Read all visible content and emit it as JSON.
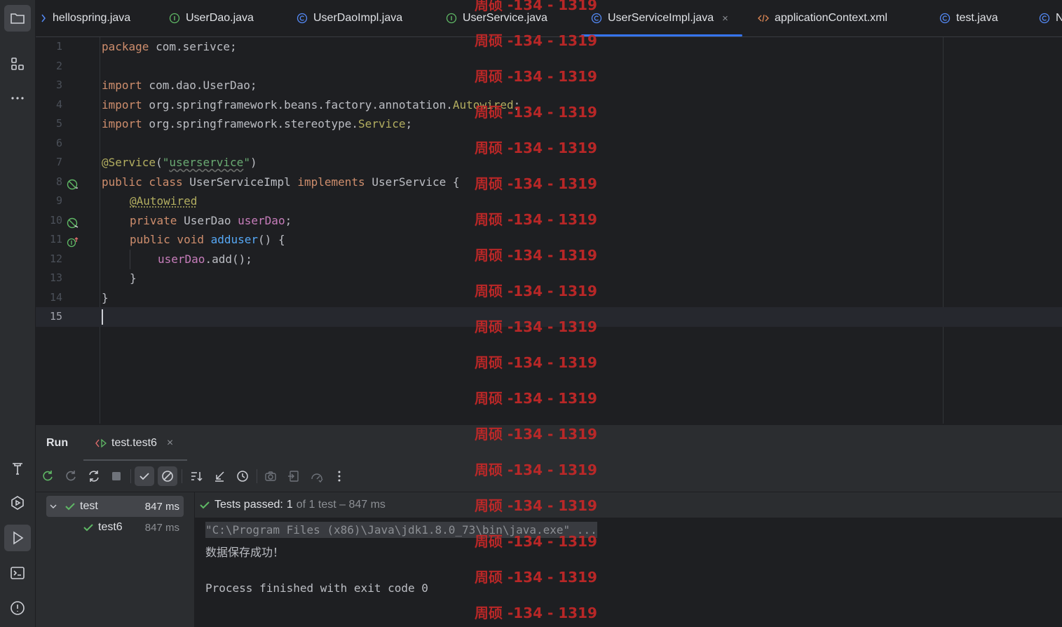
{
  "tabs": [
    {
      "label": "hellospring.java",
      "icon": "chevron-left-icon"
    },
    {
      "label": "UserDao.java",
      "icon": "interface-icon"
    },
    {
      "label": "UserDaoImpl.java",
      "icon": "class-icon"
    },
    {
      "label": "UserService.java",
      "icon": "interface-icon"
    },
    {
      "label": "UserServiceImpl.java",
      "icon": "class-icon",
      "active": true,
      "close": "×"
    },
    {
      "label": "applicationContext.xml",
      "icon": "xml-icon"
    },
    {
      "label": "test.java",
      "icon": "class-icon"
    },
    {
      "label": "N",
      "icon": "class-icon"
    }
  ],
  "editor": {
    "line_numbers": [
      "1",
      "2",
      "3",
      "4",
      "5",
      "6",
      "7",
      "8",
      "9",
      "10",
      "11",
      "12",
      "13",
      "14",
      "15"
    ],
    "current_line": "15",
    "code": {
      "l1_kw": "package",
      "l1_rest": " com.serivce;",
      "l3_kw": "import",
      "l3_rest": " com.dao.UserDao;",
      "l4_kw": "import",
      "l4_pre": " org.springframework.beans.factory.annotation.",
      "l4_ann": "Autowired",
      "l4_end": ";",
      "l5_kw": "import",
      "l5_pre": " org.springframework.stereotype.",
      "l5_ann": "Service",
      "l5_end": ";",
      "l7_ann": "@Service",
      "l7_open": "(",
      "l7_q1": "\"",
      "l7_str": "userservice",
      "l7_q2": "\"",
      "l7_close": ")",
      "l8_kw1": "public class",
      "l8_name": " UserServiceImpl ",
      "l8_kw2": "implements",
      "l8_iface": " UserService {",
      "l9_ann": "@Autowired",
      "l10_kw": "private",
      "l10_type": " UserDao ",
      "l10_field": "userDao",
      "l10_end": ";",
      "l11_kw": "public void",
      "l11_sp": " ",
      "l11_fn": "adduser",
      "l11_end": "() {",
      "l12_field": "userDao",
      "l12_end": ".add();",
      "l13": "}",
      "l14": "}"
    }
  },
  "run_panel": {
    "title": "Run",
    "tab_label": "test.test6",
    "tab_close": "×",
    "tree": [
      {
        "label": "test",
        "time": "847 ms"
      },
      {
        "label": "test6",
        "time": "847 ms"
      }
    ],
    "status_passed": "Tests passed:",
    "status_count": "1",
    "status_rest": "of 1 test – 847 ms",
    "console_cmd": "\"C:\\Program Files (x86)\\Java\\jdk1.8.0_73\\bin\\java.exe\" ...",
    "console_out": "数据保存成功！",
    "console_exit": "Process finished with exit code 0"
  },
  "watermark": "周硕 -134 - 1319",
  "colors": {
    "accent": "#3574f0",
    "pass_green": "#5fb865",
    "watermark": "#c62828"
  }
}
